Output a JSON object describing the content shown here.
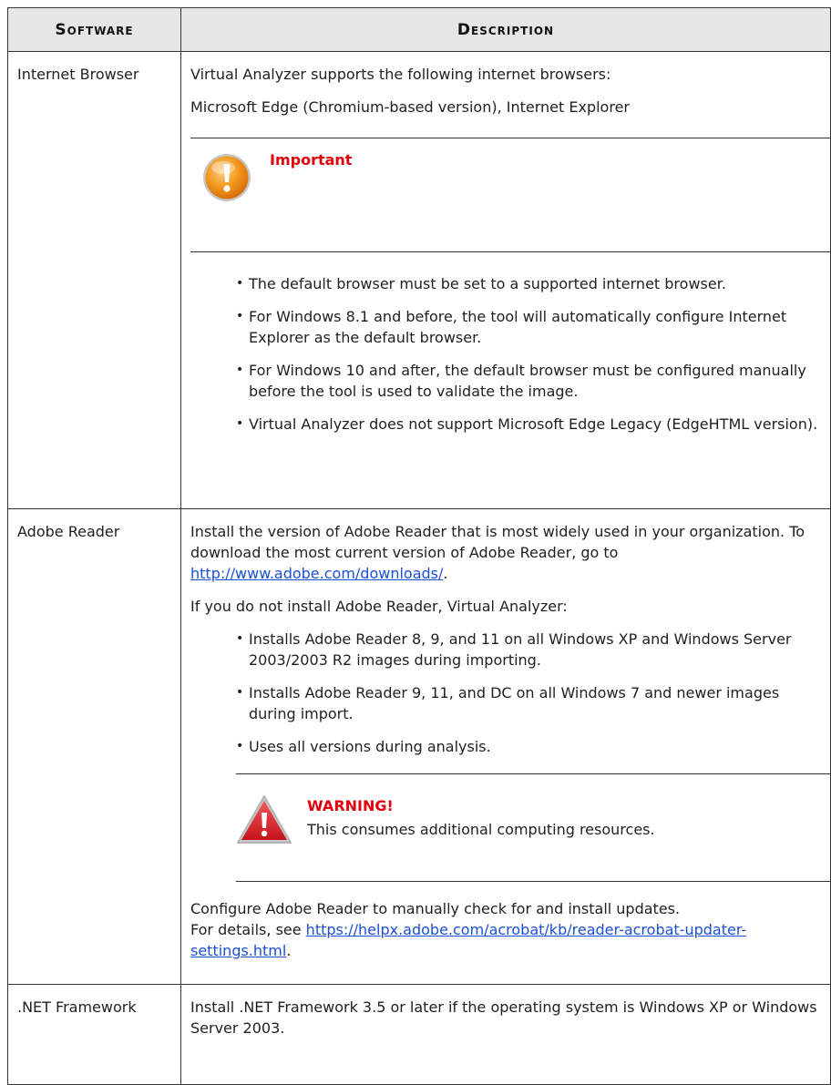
{
  "table": {
    "headers": {
      "software": "Software",
      "description": "Description"
    },
    "rows": {
      "browser": {
        "software": "Internet Browser",
        "intro": "Virtual Analyzer supports the following internet browsers:",
        "browsers": "Microsoft Edge (Chromium-based version), Internet Explorer",
        "notice": {
          "title": "Important",
          "icon": "important-icon"
        },
        "bullets": [
          "The default browser must be set to a supported internet browser.",
          "For Windows 8.1 and before, the tool will automatically configure Internet Explorer as the default browser.",
          "For Windows 10 and after, the default browser must be configured manually before the tool is used to validate the image.",
          "Virtual Analyzer does not support Microsoft Edge Legacy (EdgeHTML version)."
        ]
      },
      "adobe": {
        "software": "Adobe Reader",
        "install_text": "Install the version of Adobe Reader that is most widely used in your organization. To download the most current version of Adobe Reader, go to ",
        "download_link": "http://www.adobe.com/downloads/",
        "install_end": ".",
        "if_not": "If you do not install Adobe Reader, Virtual Analyzer:",
        "bullets": [
          "Installs Adobe Reader 8, 9, and 11 on all Windows XP and Windows Server 2003/2003 R2 images during importing.",
          "Installs Adobe Reader 9, 11, and DC on all Windows 7 and newer images during import.",
          "Uses all versions during analysis."
        ],
        "warning": {
          "title": "WARNING!",
          "text": "This consumes additional computing resources.",
          "icon": "warning-icon"
        },
        "configure_text": "Configure Adobe Reader to manually check for and install updates.",
        "details_prefix": "For details, see ",
        "details_link": "https://helpx.adobe.com/acrobat/kb/reader-acrobat-updater-settings.html",
        "details_end": "."
      },
      "dotnet": {
        "software": ".NET Framework",
        "text": "Install .NET Framework 3.5 or later if the operating system is Windows XP or Windows Server 2003."
      }
    }
  },
  "colors": {
    "header_bg": "#e6e6e6",
    "alert_red": "#e3000b",
    "link_blue": "#1a4fd6",
    "important_orange": "#f39a1f"
  }
}
